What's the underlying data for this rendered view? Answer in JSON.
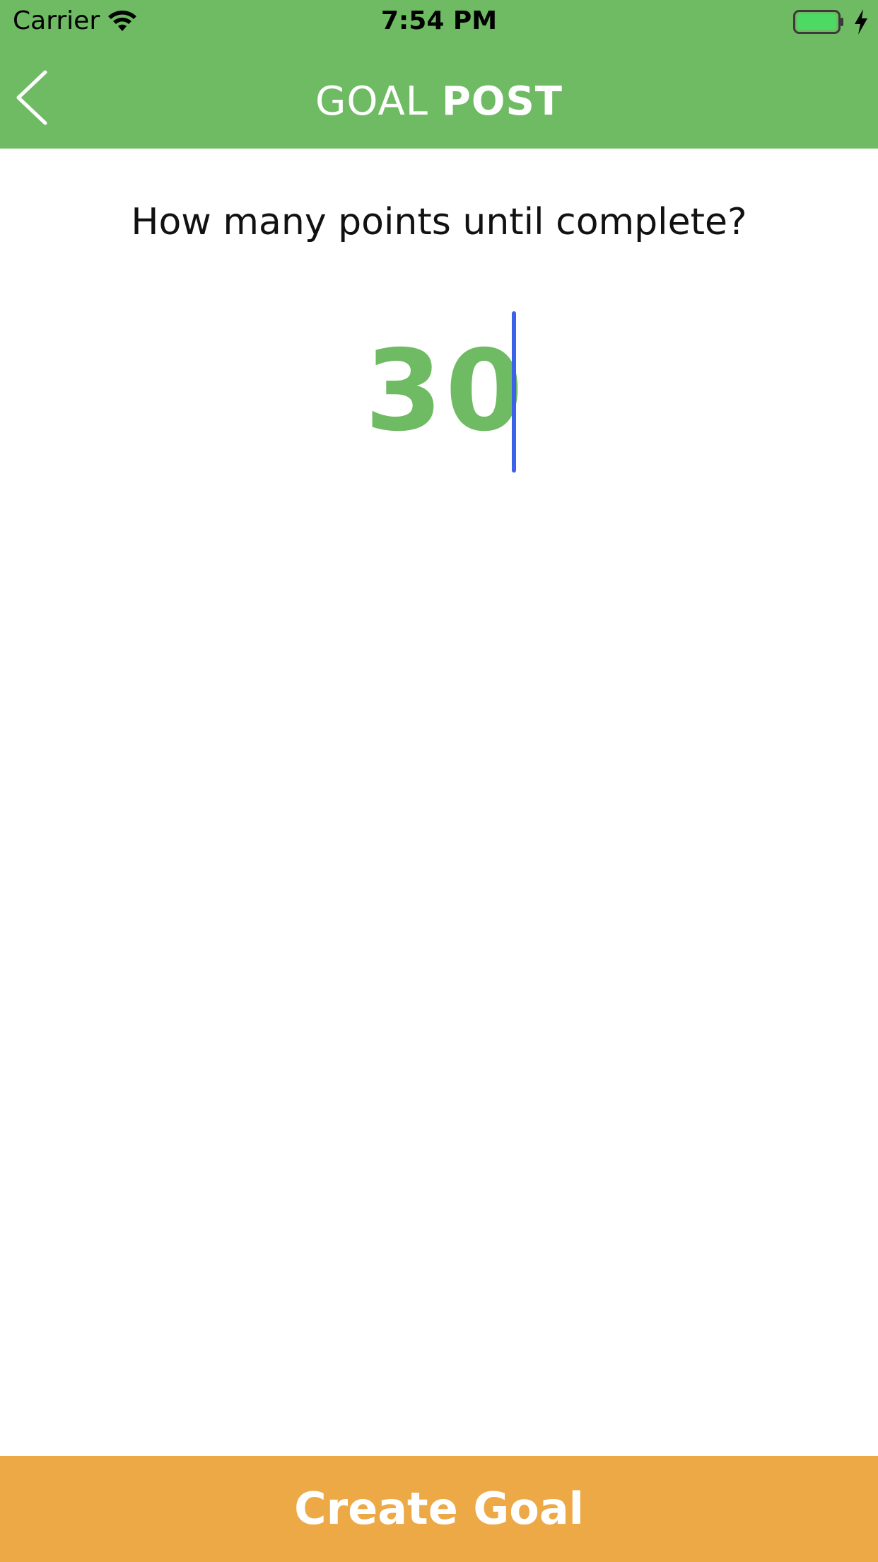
{
  "status_bar": {
    "carrier": "Carrier",
    "time": "7:54 PM",
    "icons": [
      "wifi-icon",
      "battery-icon",
      "charging-bolt-icon"
    ]
  },
  "nav": {
    "back_icon": "chevron-left-icon",
    "title_light": "GOAL",
    "title_bold": "POST"
  },
  "main": {
    "question": "How many points until complete?",
    "points_value": "30"
  },
  "footer": {
    "create_label": "Create Goal"
  },
  "colors": {
    "brand_green": "#6fbb63",
    "accent_orange": "#eca946",
    "caret_blue": "#3b62e8"
  }
}
